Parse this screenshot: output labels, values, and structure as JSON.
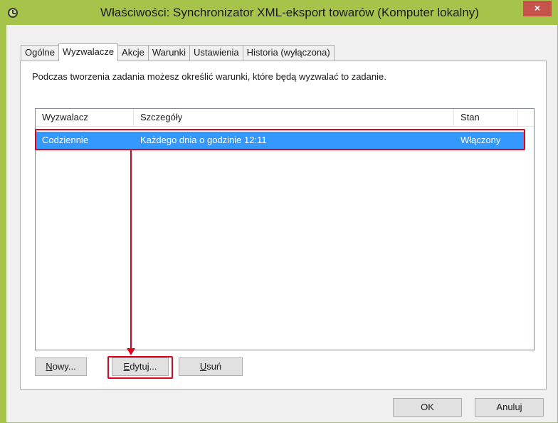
{
  "window": {
    "title": "Właściwości: Synchronizator XML-eksport towarów (Komputer lokalny)",
    "close_label": "×",
    "accent_color": "#a6c44a"
  },
  "tabs": [
    {
      "label": "Ogólne",
      "active": false
    },
    {
      "label": "Wyzwalacze",
      "active": true
    },
    {
      "label": "Akcje",
      "active": false
    },
    {
      "label": "Warunki",
      "active": false
    },
    {
      "label": "Ustawienia",
      "active": false
    },
    {
      "label": "Historia (wyłączona)",
      "active": false
    }
  ],
  "panel": {
    "description": "Podczas tworzenia zadania możesz określić warunki, które będą wyzwalać to zadanie."
  },
  "list": {
    "columns": [
      "Wyzwalacz",
      "Szczegóły",
      "Stan"
    ],
    "rows": [
      {
        "trigger": "Codziennie",
        "details": "Każdego dnia o godzinie 12:11",
        "state": "Włączony",
        "selected": true
      }
    ],
    "selection_color": "#3399ff"
  },
  "buttons": {
    "new_first": "N",
    "new_rest": "owy...",
    "edit_first": "E",
    "edit_rest": "dytuj...",
    "delete_first": "U",
    "delete_rest": "suń",
    "ok": "OK",
    "cancel": "Anuluj"
  },
  "annotation": {
    "highlight_color": "#e2001a"
  }
}
